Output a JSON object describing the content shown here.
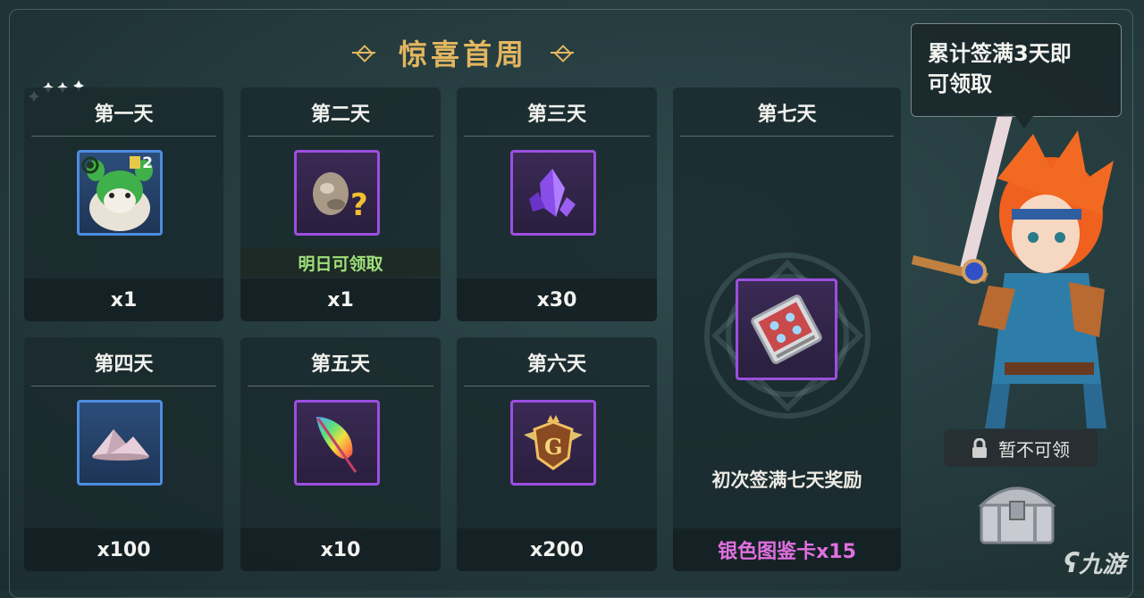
{
  "header": {
    "title": "惊喜首周"
  },
  "days": [
    {
      "title": "第一天",
      "qty": "x1",
      "icon": "green-pet-avatar-icon",
      "badge": "2"
    },
    {
      "title": "第二天",
      "qty": "x1",
      "icon": "mystery-ore-icon",
      "status": "明日可领取"
    },
    {
      "title": "第三天",
      "qty": "x30",
      "icon": "purple-crystal-icon"
    },
    {
      "title": "第四天",
      "qty": "x100",
      "icon": "powder-pile-icon"
    },
    {
      "title": "第五天",
      "qty": "x10",
      "icon": "rainbow-feather-icon"
    },
    {
      "title": "第六天",
      "qty": "x200",
      "icon": "gold-g-badge-icon"
    }
  ],
  "day7": {
    "title": "第七天",
    "icon": "silver-collection-card-icon",
    "desc": "初次签满七天奖励",
    "reward": "银色图鉴卡x15"
  },
  "tooltip": {
    "line1": "累计签满3天即",
    "line2": "可领取"
  },
  "chest_button": {
    "label": "暂不可领",
    "icon": "lock-icon"
  },
  "watermark": {
    "text": "九游"
  },
  "colors": {
    "title": "#e3b660",
    "status": "#9ee07a",
    "reward": "#e070e0",
    "blue_frame": "#4d8de0",
    "purple_frame": "#9c4fe0"
  }
}
